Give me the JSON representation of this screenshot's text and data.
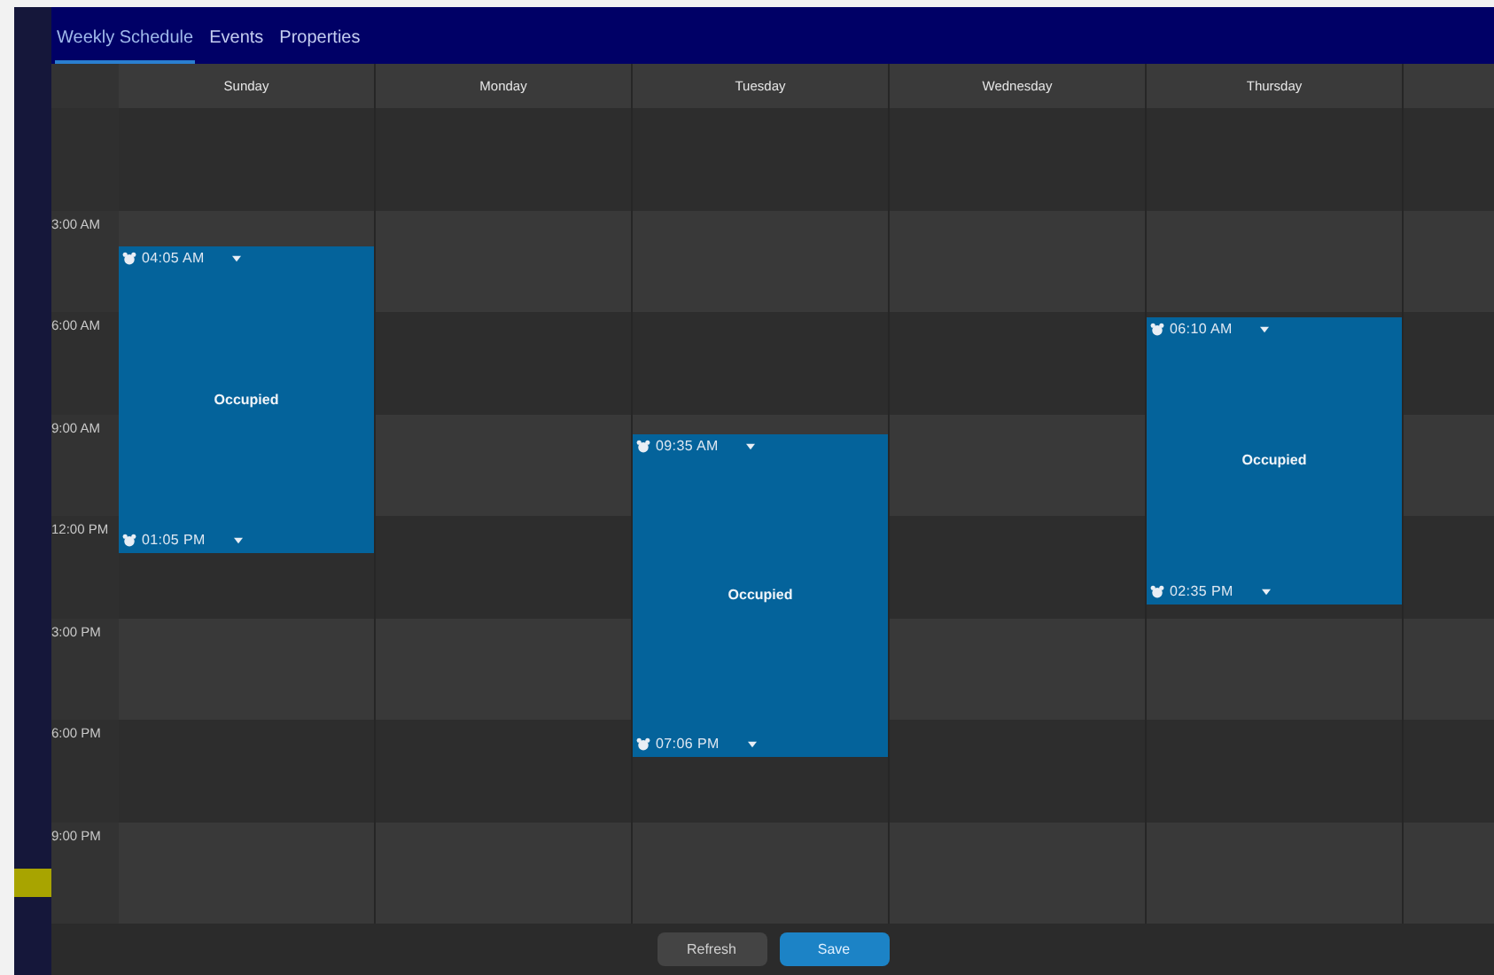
{
  "tabs": [
    {
      "label": "Weekly Schedule",
      "selected": true
    },
    {
      "label": "Events",
      "selected": false
    },
    {
      "label": "Properties",
      "selected": false
    }
  ],
  "time_labels": [
    "3:00 AM",
    "6:00 AM",
    "9:00 AM",
    "12:00 PM",
    "3:00 PM",
    "6:00 PM",
    "9:00 PM"
  ],
  "days": [
    {
      "name": "Sunday",
      "events": [
        {
          "start": "04:05 AM",
          "end": "01:05 PM",
          "label": "Occupied"
        }
      ]
    },
    {
      "name": "Monday"
    },
    {
      "name": "Tuesday",
      "events": [
        {
          "start": "09:35 AM",
          "end": "07:06 PM",
          "label": "Occupied"
        }
      ]
    },
    {
      "name": "Wednesday"
    },
    {
      "name": "Thursday",
      "events": [
        {
          "start": "06:10 AM",
          "end": "02:35 PM",
          "label": "Occupied"
        }
      ]
    }
  ],
  "buttons": [
    {
      "label": "Refresh",
      "kind": "secondary"
    },
    {
      "label": "Save",
      "kind": "primary"
    }
  ]
}
